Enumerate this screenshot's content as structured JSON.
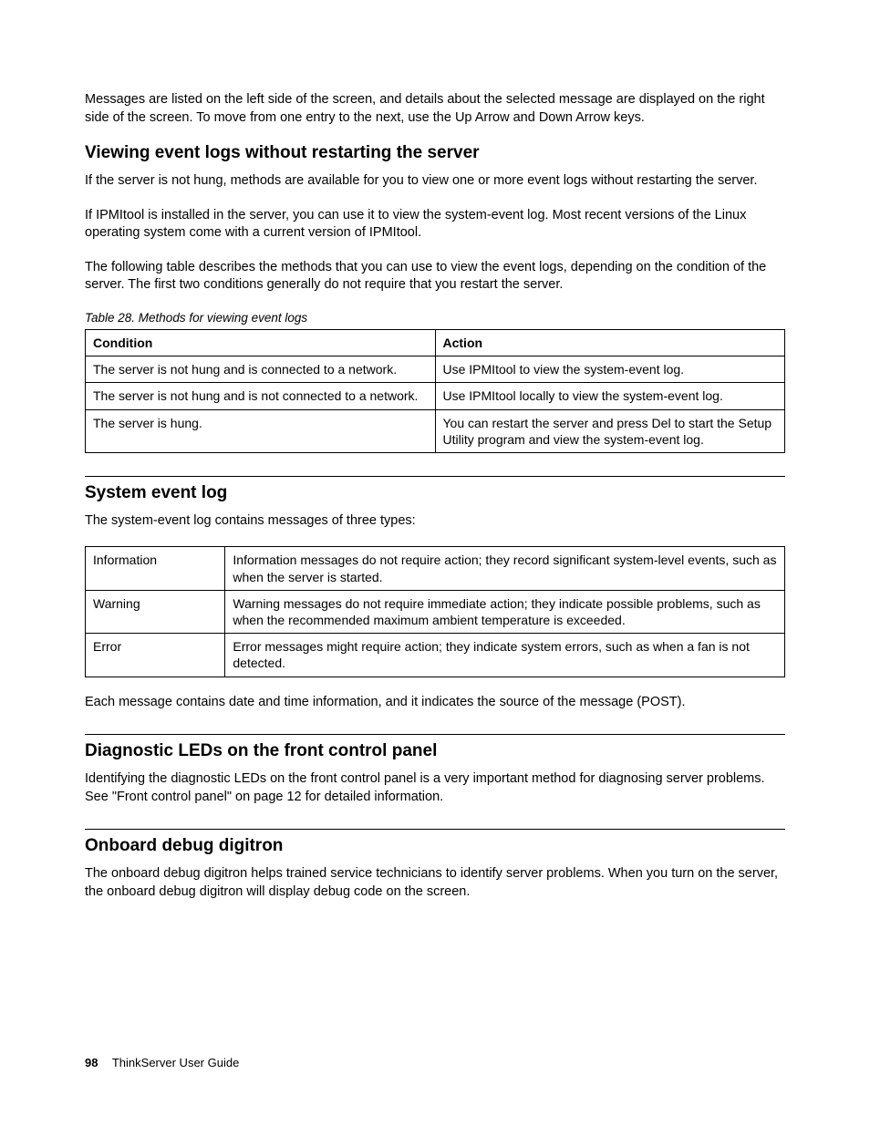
{
  "intro_para": "Messages are listed on the left side of the screen, and details about the selected message are displayed on the right side of the screen. To move from one entry to the next, use the Up Arrow and Down Arrow keys.",
  "section1": {
    "heading": "Viewing event logs without restarting the server",
    "para1": "If the server is not hung, methods are available for you to view one or more event logs without restarting the server.",
    "para2": "If IPMItool is installed in the server, you can use it to view the system-event log. Most recent versions of the Linux operating system come with a current version of IPMItool.",
    "para3": "The following table describes the methods that you can use to view the event logs, depending on the condition of the server. The first two conditions generally do not require that you restart the server.",
    "table_caption": "Table 28.  Methods for viewing event logs",
    "table": {
      "headers": [
        "Condition",
        "Action"
      ],
      "rows": [
        [
          "The server is not hung and is connected to a network.",
          "Use IPMItool to view the system-event log."
        ],
        [
          "The server is not hung and is not connected to a network.",
          "Use IPMItool locally to view the system-event log."
        ],
        [
          "The server is hung.",
          "You can restart the server and press Del to start the Setup Utility program and view the system-event log."
        ]
      ]
    }
  },
  "section2": {
    "heading": "System event log",
    "para1": "The system-event log contains messages of three types:",
    "table": {
      "rows": [
        [
          "Information",
          "Information messages do not require action; they record significant system-level events, such as when the server is started."
        ],
        [
          "Warning",
          "Warning messages do not require immediate action; they indicate possible problems, such as when the recommended maximum ambient temperature is exceeded."
        ],
        [
          "Error",
          "Error messages might require action; they indicate system errors, such as when a fan is not detected."
        ]
      ]
    },
    "para2": "Each message contains date and time information, and it indicates the source of the message (POST)."
  },
  "section3": {
    "heading": "Diagnostic LEDs on the front control panel",
    "para1": "Identifying the diagnostic LEDs on the front control panel is a very important method for diagnosing server problems. See \"Front control panel\" on page 12 for detailed information."
  },
  "section4": {
    "heading": "Onboard debug digitron",
    "para1": "The onboard debug digitron helps trained service technicians to identify server problems. When you turn on the server, the onboard debug digitron will display debug code on the screen."
  },
  "footer": {
    "page_number": "98",
    "book_title": "ThinkServer User Guide"
  }
}
